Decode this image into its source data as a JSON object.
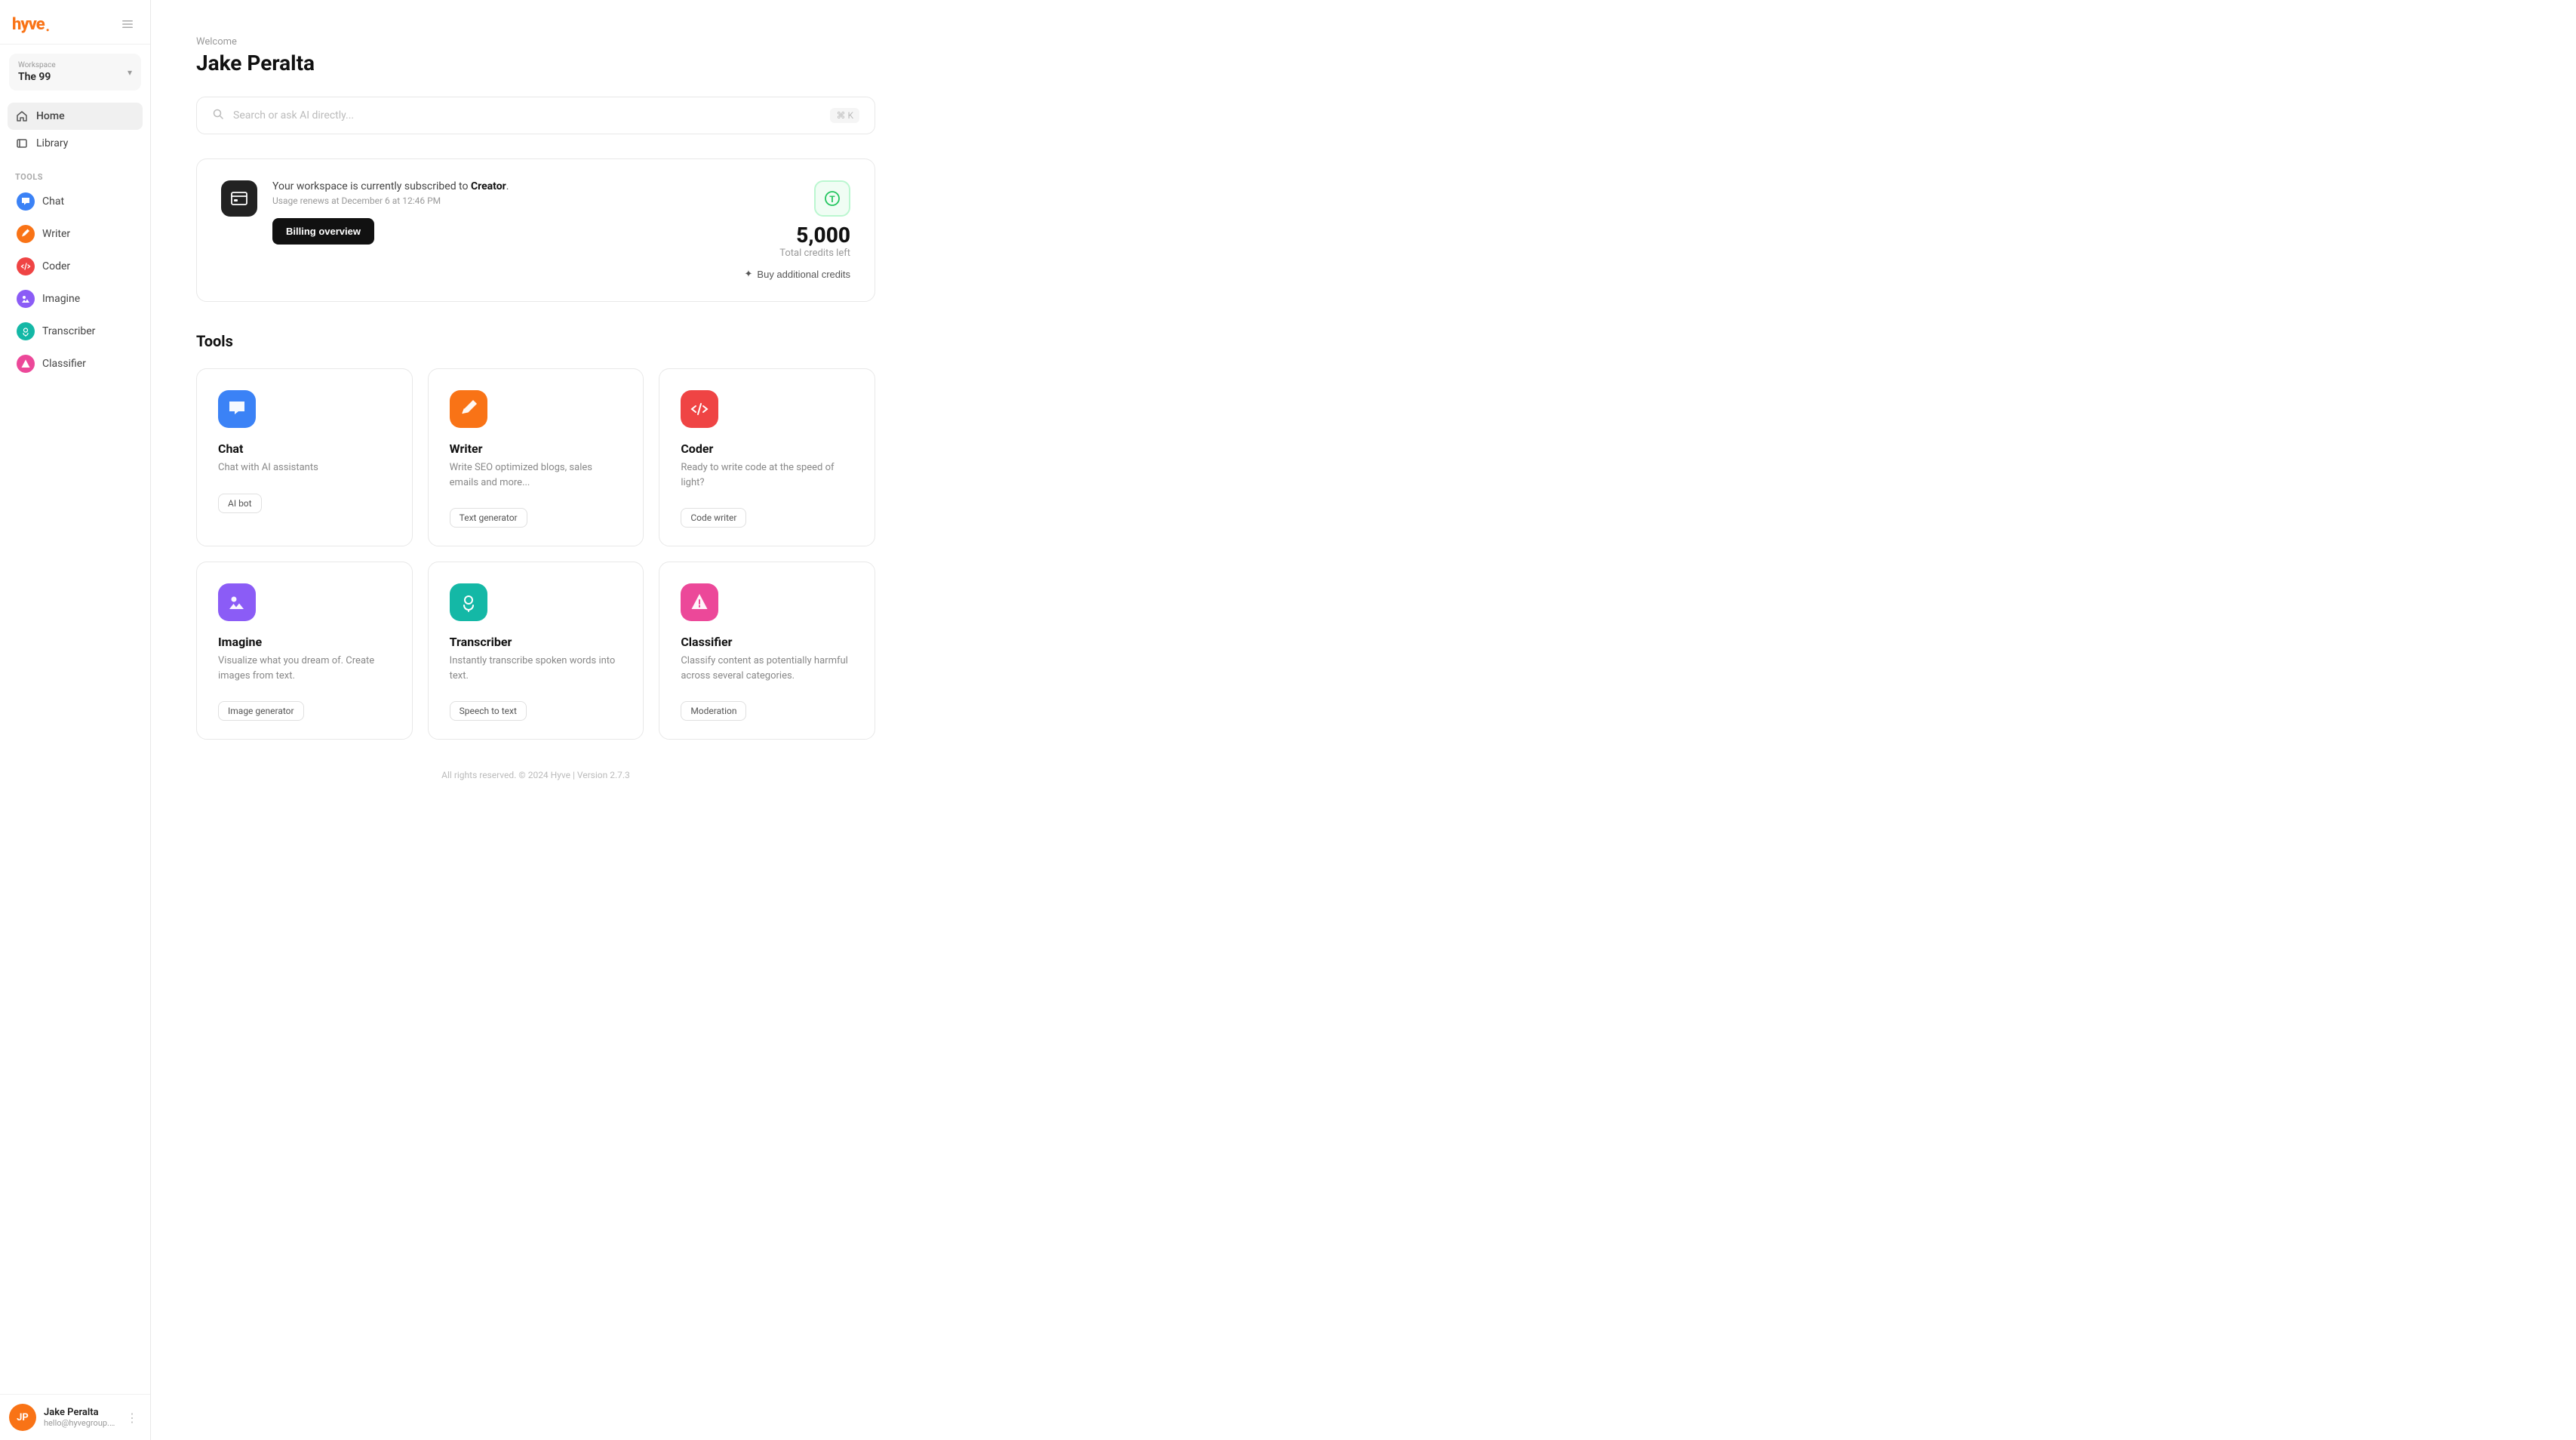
{
  "logo": {
    "text": "hyve",
    "dot": "."
  },
  "sidebar_toggle_label": "toggle sidebar",
  "workspace": {
    "label": "Workspace",
    "name": "The 99"
  },
  "nav": {
    "home": "Home",
    "library": "Library"
  },
  "tools_label": "Tools",
  "tool_nav_items": [
    {
      "id": "chat",
      "label": "Chat",
      "color": "#3b82f6",
      "icon": "💬"
    },
    {
      "id": "writer",
      "label": "Writer",
      "color": "#f97316",
      "icon": "✏️"
    },
    {
      "id": "coder",
      "label": "Coder",
      "color": "#ef4444",
      "icon": "⌨️"
    },
    {
      "id": "imagine",
      "label": "Imagine",
      "color": "#8b5cf6",
      "icon": "🎨"
    },
    {
      "id": "transcriber",
      "label": "Transcriber",
      "color": "#14b8a6",
      "icon": "🎙️"
    },
    {
      "id": "classifier",
      "label": "Classifier",
      "color": "#ec4899",
      "icon": "🏷️"
    }
  ],
  "user": {
    "name": "Jake Peralta",
    "email": "hello@hyvegroup.co",
    "initials": "JP"
  },
  "welcome": {
    "greeting": "Welcome",
    "name": "Jake Peralta"
  },
  "search": {
    "placeholder": "Search or ask AI directly...",
    "shortcut": "⌘ K"
  },
  "billing": {
    "plan_text": "Your workspace is currently subscribed to ",
    "plan_name": "Creator",
    "plan_suffix": ".",
    "renew_text": "Usage renews at December 6 at 12:46 PM",
    "billing_btn": "Billing overview",
    "credits_number": "5,000",
    "credits_label": "Total credits left",
    "buy_btn": "Buy additional credits"
  },
  "tools_section": {
    "title": "Tools",
    "items": [
      {
        "id": "chat",
        "name": "Chat",
        "desc": "Chat with AI assistants",
        "tag": "AI bot",
        "color": "#3b82f6",
        "icon": "chat"
      },
      {
        "id": "writer",
        "name": "Writer",
        "desc": "Write SEO optimized blogs, sales emails and more...",
        "tag": "Text generator",
        "color": "#f97316",
        "icon": "writer"
      },
      {
        "id": "coder",
        "name": "Coder",
        "desc": "Ready to write code at the speed of light?",
        "tag": "Code writer",
        "color": "#ef4444",
        "icon": "coder"
      },
      {
        "id": "imagine",
        "name": "Imagine",
        "desc": "Visualize what you dream of. Create images from text.",
        "tag": "Image generator",
        "color": "#8b5cf6",
        "icon": "imagine"
      },
      {
        "id": "transcriber",
        "name": "Transcriber",
        "desc": "Instantly transcribe spoken words into text.",
        "tag": "Speech to text",
        "color": "#14b8a6",
        "icon": "transcriber"
      },
      {
        "id": "classifier",
        "name": "Classifier",
        "desc": "Classify content as potentially harmful across several categories.",
        "tag": "Moderation",
        "color": "#ec4899",
        "icon": "classifier"
      }
    ]
  },
  "footer": {
    "text": "All rights reserved. © 2024 Hyve | Version 2.7.3"
  }
}
